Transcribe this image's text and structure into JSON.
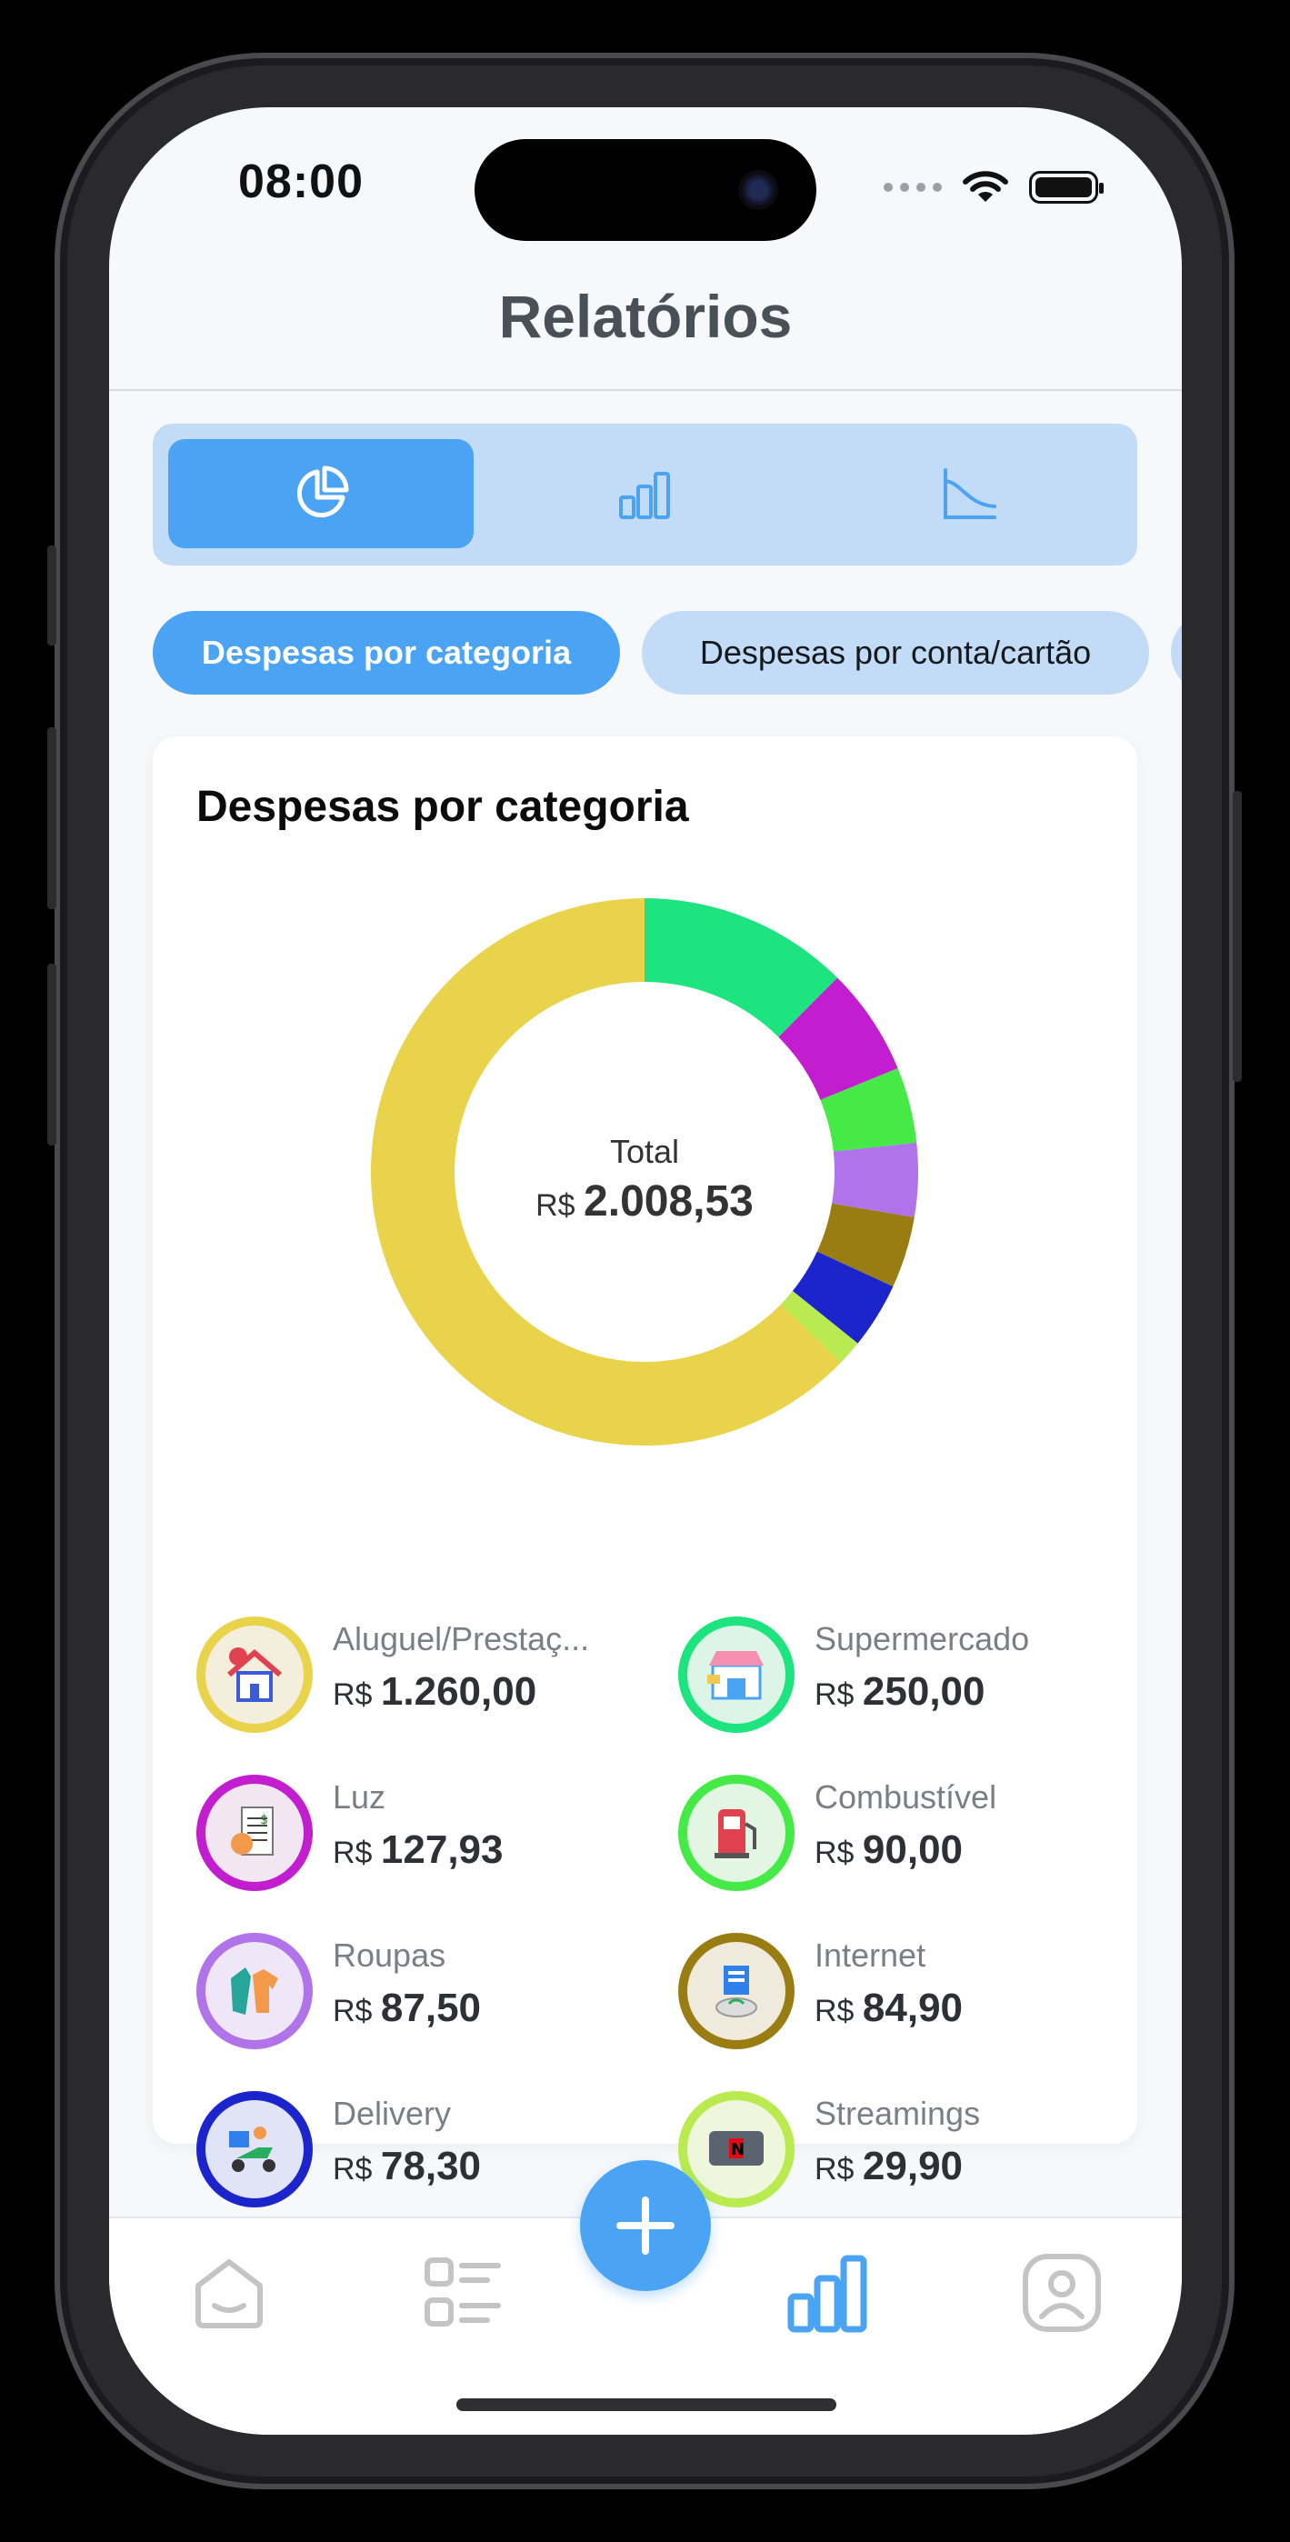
{
  "status_bar": {
    "time": "08:00"
  },
  "header": {
    "title": "Relatórios"
  },
  "view_switcher": {
    "options": [
      {
        "icon": "pie-chart-icon",
        "active": true
      },
      {
        "icon": "bar-chart-icon",
        "active": false
      },
      {
        "icon": "line-chart-icon",
        "active": false
      }
    ]
  },
  "chips": [
    {
      "label": "Despesas por categoria",
      "active": true
    },
    {
      "label": "Despesas por conta/cartão",
      "active": false
    }
  ],
  "card": {
    "title": "Despesas por categoria",
    "total_label": "Total",
    "total_currency": "R$",
    "total_value": "2.008,53"
  },
  "chart_data": {
    "type": "pie",
    "title": "Despesas por categoria",
    "total": 2008.53,
    "categories": [
      "Aluguel/Prestaç...",
      "Supermercado",
      "Luz",
      "Combustível",
      "Roupas",
      "Internet",
      "Delivery",
      "Streamings"
    ],
    "values": [
      1260.0,
      250.0,
      127.93,
      90.0,
      87.5,
      84.9,
      78.3,
      29.9
    ],
    "colors": [
      "#e8d34a",
      "#1de47f",
      "#c21ed0",
      "#46ea46",
      "#b073ea",
      "#9a7d12",
      "#1c24cc",
      "#b9ea4f"
    ]
  },
  "legend": [
    {
      "name": "Aluguel/Prestaç...",
      "currency": "R$",
      "value": "1.260,00",
      "color": "#e8d34a",
      "icon": "house-icon"
    },
    {
      "name": "Supermercado",
      "currency": "R$",
      "value": "250,00",
      "color": "#1de47f",
      "icon": "store-icon"
    },
    {
      "name": "Luz",
      "currency": "R$",
      "value": "127,93",
      "color": "#c21ed0",
      "icon": "bill-icon"
    },
    {
      "name": "Combustível",
      "currency": "R$",
      "value": "90,00",
      "color": "#46ea46",
      "icon": "fuel-pump-icon"
    },
    {
      "name": "Roupas",
      "currency": "R$",
      "value": "87,50",
      "color": "#b073ea",
      "icon": "clothes-icon"
    },
    {
      "name": "Internet",
      "currency": "R$",
      "value": "84,90",
      "color": "#9a7d12",
      "icon": "router-icon"
    },
    {
      "name": "Delivery",
      "currency": "R$",
      "value": "78,30",
      "color": "#1c24cc",
      "icon": "delivery-scooter-icon"
    },
    {
      "name": "Streamings",
      "currency": "R$",
      "value": "29,90",
      "color": "#b9ea4f",
      "icon": "tv-streaming-icon"
    }
  ],
  "tab_bar": {
    "tabs": [
      {
        "icon": "home-icon",
        "active": false
      },
      {
        "icon": "list-icon",
        "active": false
      },
      {
        "icon": "add-icon",
        "active": false
      },
      {
        "icon": "reports-bar-chart-icon",
        "active": true
      },
      {
        "icon": "profile-icon",
        "active": false
      }
    ],
    "accent": "#4aa3f3",
    "inactive_color": "#c4c4c4"
  }
}
